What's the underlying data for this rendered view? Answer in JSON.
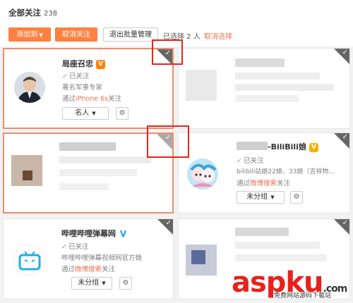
{
  "header": {
    "title": "全部关注",
    "count": "238"
  },
  "toolbar": {
    "add_to_label": "添加到",
    "unfollow_label": "取消关注",
    "exit_batch_label": "退出批量管理",
    "selected_text": "已选择 2 人",
    "cancel_select_label": "取消选择"
  },
  "cards": [
    {
      "name": "局座召忠",
      "badge": "V",
      "status": "已关注",
      "desc": "著名军事专家",
      "via_prefix": "通过",
      "via_source": "iPhone 6s",
      "via_suffix": "关注",
      "group": "名人"
    },
    {
      "name": "-BiliBili娘",
      "badge": "V",
      "status": "已关注",
      "desc": "bilibili站娘22娘、33娘（吉祥物…",
      "via_prefix": "通过",
      "via_source": "微博搜索",
      "via_suffix": "关注",
      "group": "未分组"
    },
    {
      "name": "哔哩哔哩弹幕网",
      "badge": "V",
      "status": "已关注",
      "desc": "哔哩哔哩弹幕视频网官方微",
      "via_prefix": "通过",
      "via_source": "微博搜索",
      "via_suffix": "关注",
      "group": "未分组"
    }
  ],
  "icons": {
    "checkmark": "check-icon",
    "gear": "gear-icon",
    "dropdown": "caret-down-icon"
  },
  "colors": {
    "accent": "#ff8140",
    "link": "#eb7350",
    "highlight": "#e0261c",
    "verified_blue": "#2a9df4"
  },
  "watermark": {
    "main": "aspku",
    "suffix": ".com",
    "sub": "免费网站源码下载站"
  }
}
